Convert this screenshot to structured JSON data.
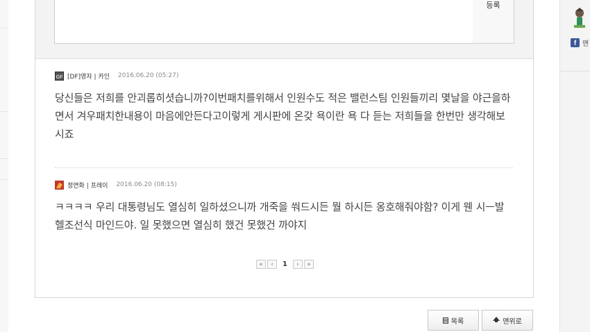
{
  "write_form": {
    "submit_label": "등록"
  },
  "comments": [
    {
      "author": "[DF]영자 | 카인",
      "date": "2016.06.20 (05:27)",
      "body": "당신들은 저희를 안괴롭히셧습니까?이번패치를위해서 인원수도 적은 밸런스팀 인원들끼리 몇날을 야근을하면서 겨우패치한내용이 마음에안든다고이렇게 게시판에 온갖 욕이란 욕 다 듣는 저희들을 한번만 생각해보시죠",
      "icon": "df-gm-badge-icon",
      "icon_color": "#2b2b2b"
    },
    {
      "author": "정연화 | 프레이",
      "date": "2016.06.20 (08:15)",
      "body": "ㅋㅋㅋㅋ 우리 대통령님도 열심히 일하셨으니까 개죽을 쒀드시든 뭘 하시든 옹호해줘야함? 이게 웬 시ㅡ발 헬조선식 마인드야. 일 못했으면 열심히 했건 못했건 까야지",
      "icon": "fighter-class-icon",
      "icon_color": "#c0392b"
    }
  ],
  "pagination": {
    "first": "«",
    "prev": "‹",
    "current": "1",
    "next": "›",
    "last": "»"
  },
  "actions": {
    "list_label": "목록",
    "top_label": "맨위로"
  },
  "sidebar": {
    "facebook_label": "맨"
  },
  "colors": {
    "facebook": "#3b5998",
    "border": "#d6d6d6"
  }
}
